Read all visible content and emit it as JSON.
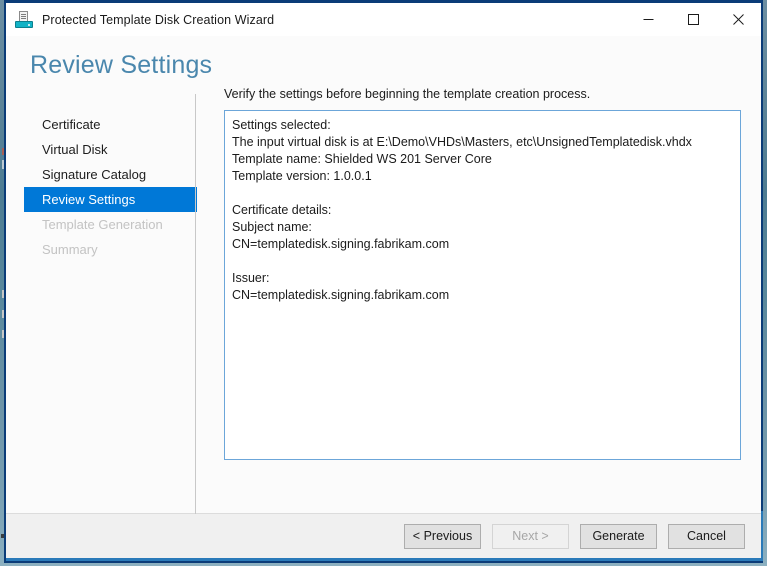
{
  "window": {
    "title": "Protected Template Disk Creation Wizard",
    "icon": "protected-template-disk-icon",
    "controls": {
      "minimize": "minimize-icon",
      "maximize": "maximize-icon",
      "close": "close-icon"
    }
  },
  "page": {
    "heading": "Review Settings",
    "heading_color": "#4a87ad"
  },
  "sidebar": {
    "items": [
      {
        "label": "Certificate",
        "state": "normal"
      },
      {
        "label": "Virtual Disk",
        "state": "normal"
      },
      {
        "label": "Signature Catalog",
        "state": "normal"
      },
      {
        "label": "Review Settings",
        "state": "selected"
      },
      {
        "label": "Template Generation",
        "state": "disabled"
      },
      {
        "label": "Summary",
        "state": "disabled"
      }
    ],
    "selected_color": "#0078d7",
    "disabled_color": "#c3c3c3"
  },
  "content": {
    "intro": "Verify the settings before beginning the template creation process.",
    "settings_text": "Settings selected:\nThe input virtual disk is at E:\\Demo\\VHDs\\Masters, etc\\UnsignedTemplatedisk.vhdx\nTemplate name: Shielded WS 201 Server Core\nTemplate version: 1.0.0.1\n\nCertificate details:\nSubject name:\nCN=templatedisk.signing.fabrikam.com\n\nIssuer:\nCN=templatedisk.signing.fabrikam.com",
    "box_border_color": "#6ca6d9"
  },
  "footer": {
    "buttons": [
      {
        "label": "< Previous",
        "state": "enabled"
      },
      {
        "label": "Next >",
        "state": "disabled"
      },
      {
        "label": "Generate",
        "state": "enabled"
      },
      {
        "label": "Cancel",
        "state": "enabled"
      }
    ]
  }
}
